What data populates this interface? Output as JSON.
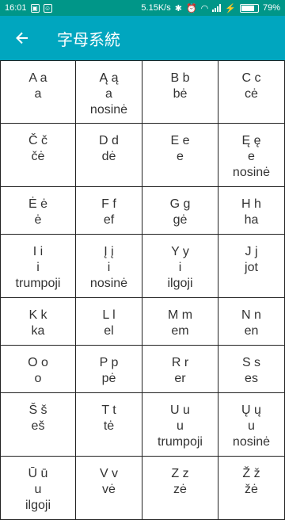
{
  "status": {
    "time": "16:01",
    "speed": "5.15K/s",
    "battery": "79%",
    "battery_level": 0.79
  },
  "header": {
    "title": "字母系統"
  },
  "letters": [
    {
      "letter": "A a",
      "name": "a"
    },
    {
      "letter": "Ą ą",
      "name": "a",
      "extra": "nosinė"
    },
    {
      "letter": "B b",
      "name": "bė"
    },
    {
      "letter": "C c",
      "name": "cė"
    },
    {
      "letter": "Č č",
      "name": "čė"
    },
    {
      "letter": "D d",
      "name": "dė"
    },
    {
      "letter": "E e",
      "name": "e"
    },
    {
      "letter": "Ę ę",
      "name": "e",
      "extra": "nosinė"
    },
    {
      "letter": "Ė ė",
      "name": "ė"
    },
    {
      "letter": "F f",
      "name": "ef"
    },
    {
      "letter": "G g",
      "name": "gė"
    },
    {
      "letter": "H h",
      "name": "ha"
    },
    {
      "letter": "I i",
      "name": "i",
      "extra": "trumpoji"
    },
    {
      "letter": "Į į",
      "name": "i",
      "extra": "nosinė"
    },
    {
      "letter": "Y y",
      "name": "i",
      "extra": "ilgoji"
    },
    {
      "letter": "J j",
      "name": "jot"
    },
    {
      "letter": "K k",
      "name": "ka"
    },
    {
      "letter": "L l",
      "name": "el"
    },
    {
      "letter": "M m",
      "name": "em"
    },
    {
      "letter": "N n",
      "name": "en"
    },
    {
      "letter": "O o",
      "name": "o"
    },
    {
      "letter": "P p",
      "name": "pė"
    },
    {
      "letter": "R r",
      "name": "er"
    },
    {
      "letter": "S s",
      "name": "es"
    },
    {
      "letter": "Š š",
      "name": "eš"
    },
    {
      "letter": "T t",
      "name": "tė"
    },
    {
      "letter": "U u",
      "name": "u",
      "extra": "trumpoji"
    },
    {
      "letter": "Ų ų",
      "name": "u",
      "extra": "nosinė"
    },
    {
      "letter": "Ū ū",
      "name": "u",
      "extra": "ilgoji"
    },
    {
      "letter": "V v",
      "name": "vė"
    },
    {
      "letter": "Z z",
      "name": "zė"
    },
    {
      "letter": "Ž ž",
      "name": "žė"
    }
  ]
}
